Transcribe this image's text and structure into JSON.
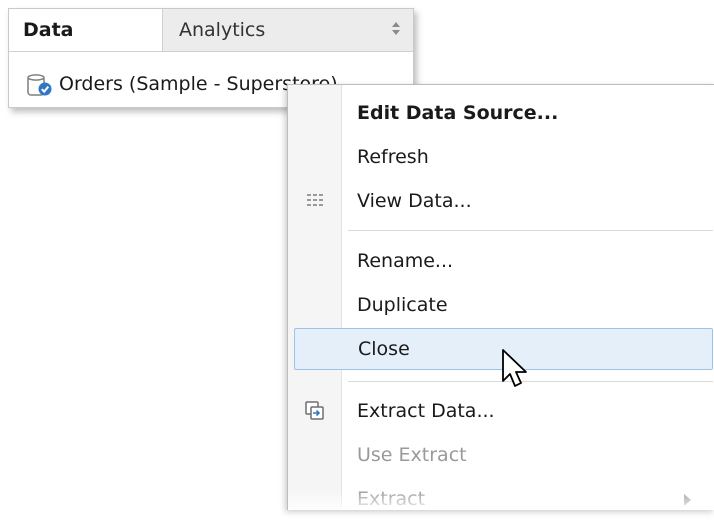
{
  "tabs": {
    "data_label": "Data",
    "analytics_label": "Analytics"
  },
  "data_source": {
    "name": "Orders (Sample - Superstore)",
    "icon": "database-connected-icon"
  },
  "context_menu": {
    "items": [
      {
        "label": "Edit Data Source...",
        "bold": true
      },
      {
        "label": "Refresh"
      },
      {
        "label": "View Data...",
        "icon": "grid-icon"
      },
      {
        "label": "Rename..."
      },
      {
        "label": "Duplicate"
      },
      {
        "label": "Close",
        "hovered": true
      },
      {
        "label": "Extract Data...",
        "icon": "extract-icon"
      },
      {
        "label": "Use Extract",
        "disabled": true
      },
      {
        "label": "Extract",
        "disabled": true,
        "has_submenu": true
      }
    ]
  },
  "colors": {
    "hover_fill": "#e5eff9",
    "hover_border": "#9fc3e6",
    "gutter": "#f5f5f5",
    "tab_inactive": "#ececec",
    "icon_blue": "#2f78c8"
  }
}
